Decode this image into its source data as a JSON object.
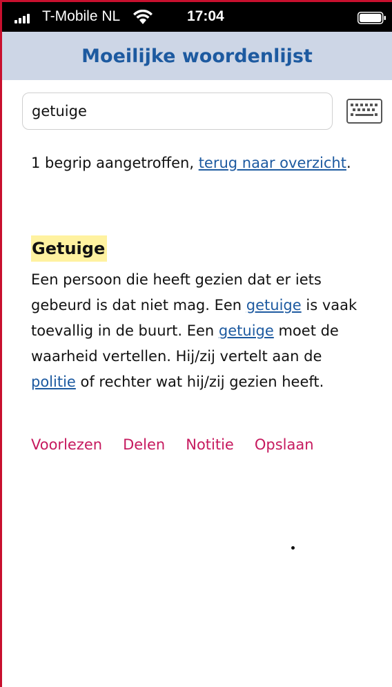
{
  "status_bar": {
    "carrier": "T-Mobile NL",
    "time": "17:04"
  },
  "header": {
    "title": "Moeilijke woordenlijst"
  },
  "search": {
    "value": "getuige"
  },
  "result": {
    "count_text": "1 begrip aangetroffen, ",
    "back_link": "terug naar overzicht",
    "period": "."
  },
  "entry": {
    "term": "Getuige",
    "def_1": "Een persoon die heeft gezien dat er iets gebeurd is dat niet mag. Een ",
    "link_1": "getuige",
    "def_2": " is vaak toevallig in de buurt. Een ",
    "link_2": "getuige",
    "def_3": " moet de waarheid vertellen. Hij/zij vertelt aan de ",
    "link_3": "politie",
    "def_4": " of rechter wat hij/zij gezien heeft."
  },
  "actions": {
    "read_aloud": "Voorlezen",
    "share": "Delen",
    "note": "Notitie",
    "save": "Opslaan"
  },
  "colors": {
    "header_bg": "#cdd6e6",
    "title": "#1d5aa0",
    "link": "#1d5aa0",
    "action": "#c6195e",
    "highlight": "#fff2a0",
    "frame": "#c8102e"
  }
}
